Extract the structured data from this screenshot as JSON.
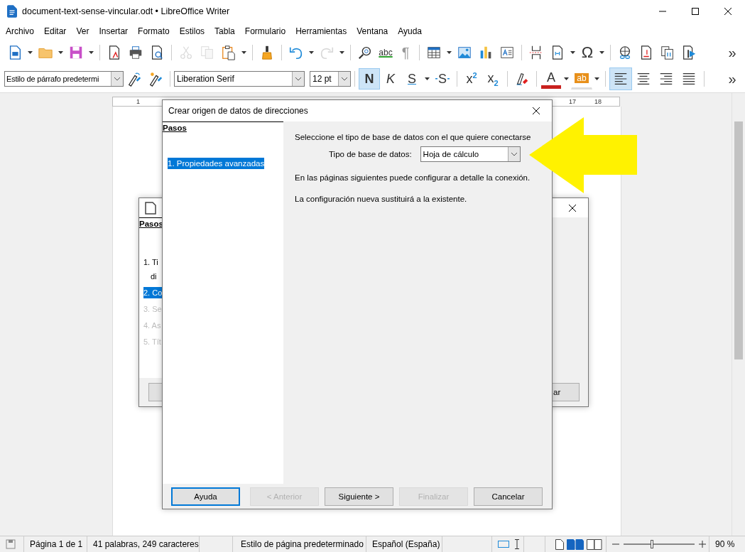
{
  "window": {
    "title": "document-text-sense-vincular.odt • LibreOffice Writer"
  },
  "menu": [
    "Archivo",
    "Editar",
    "Ver",
    "Insertar",
    "Formato",
    "Estilos",
    "Tabla",
    "Formulario",
    "Herramientas",
    "Ventana",
    "Ayuda"
  ],
  "standard_toolbar": {
    "cut": {
      "disabled": true
    },
    "copy": {
      "disabled": true
    },
    "redo": {
      "disabled": true
    },
    "spelling": {
      "label": "abc"
    },
    "formatting_marks": {
      "label": "¶",
      "on": false
    },
    "special_character": {
      "label": "Ω"
    },
    "overflow": "»"
  },
  "formatting_toolbar": {
    "paragraph_style": "Estilo de párrafo predetermi",
    "font_name": "Liberation Serif",
    "font_size": "12 pt",
    "buttons": [
      {
        "kind": "bold",
        "label": "N",
        "on": true
      },
      {
        "kind": "italic",
        "label": "K",
        "on": false
      },
      {
        "kind": "underline",
        "label": "S",
        "on": false
      },
      {
        "kind": "strikethrough",
        "label": "S",
        "on": false
      },
      {
        "kind": "superscript",
        "label": "x$^{2}$",
        "on": false
      },
      {
        "kind": "subscript",
        "label": "x$_{2}$",
        "on": false
      }
    ],
    "font_color": "A",
    "highlight": "ab",
    "alignment": [
      {
        "selected": true
      },
      {
        "selected": false
      },
      {
        "selected": false
      },
      {
        "selected": false
      }
    ],
    "overflow": "»"
  },
  "ruler": {
    "labels": [
      "1",
      "17",
      "18"
    ]
  },
  "background_dialog": {
    "steps_heading": "Pasos",
    "steps": [
      {
        "lines": [
          "1. Ti",
          "di"
        ],
        "selected": false,
        "disabled": false
      },
      {
        "lines": [
          "2. Co"
        ],
        "selected": true,
        "disabled": false
      },
      {
        "lines": [
          "3. Se"
        ],
        "selected": false,
        "disabled": true
      },
      {
        "lines": [
          "4. As"
        ],
        "selected": false,
        "disabled": true
      },
      {
        "lines": [
          "5. Tít"
        ],
        "selected": false,
        "disabled": true
      }
    ],
    "buttons": [
      "ar"
    ]
  },
  "dialog": {
    "title": "Crear origen de datos de direcciones",
    "steps_heading": "Pasos",
    "steps": [
      {
        "label": "1. Propiedades avanzadas",
        "selected": true
      }
    ],
    "intro": "Seleccione el tipo de base de datos con el que quiere conectarse",
    "field": {
      "label": "Tipo de base de datos:",
      "value": "Hoja de cálculo"
    },
    "notes": [
      "En las páginas siguientes puede configurar a detalle la conexión.",
      "La configuración nueva sustituirá a la existente."
    ],
    "buttons": [
      {
        "label": "Ayuda",
        "disabled": false,
        "focused": true
      },
      {
        "label": "< Anterior",
        "disabled": true,
        "focused": false
      },
      {
        "label": "Siguiente >",
        "disabled": false,
        "focused": false
      },
      {
        "label": "Finalizar",
        "disabled": true,
        "focused": false
      },
      {
        "label": "Cancelar",
        "disabled": false,
        "focused": false
      }
    ]
  },
  "status_bar": {
    "page": "Página 1 de 1",
    "word_count": "41 palabras, 249 caracteres",
    "page_style": "Estilo de página predeterminado",
    "language": "Español (España)",
    "view_modes": [
      {
        "selected": false
      },
      {
        "selected": true
      },
      {
        "selected": false
      }
    ],
    "zoom": {
      "level": 0.4,
      "reading": "90 %"
    }
  }
}
